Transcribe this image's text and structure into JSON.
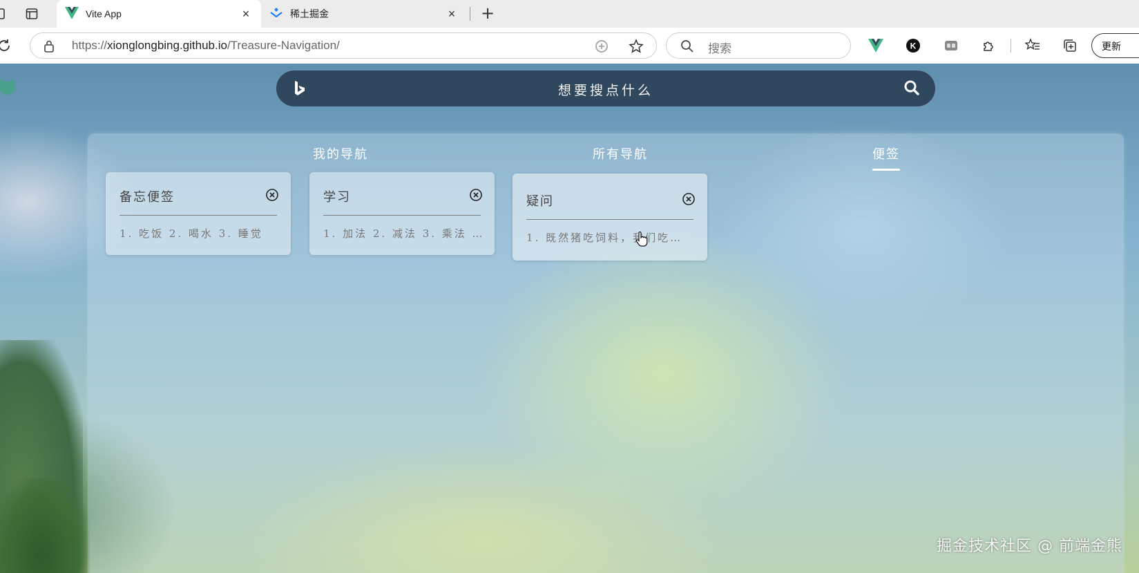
{
  "browser": {
    "tabs": [
      {
        "title": "Vite App",
        "icon": "vue-icon",
        "active": true
      },
      {
        "title": "稀土掘金",
        "icon": "juejin-icon",
        "active": false
      }
    ],
    "new_tab_label": "+",
    "close_label": "×",
    "address": {
      "scheme": "https://",
      "host": "xionglongbing.github.io",
      "path": "/Treasure-Navigation/"
    },
    "search_placeholder": "搜索",
    "update_button": "更新"
  },
  "page": {
    "search": {
      "placeholder": "想要搜点什么"
    },
    "tabs": [
      {
        "label": "我的导航",
        "active": false
      },
      {
        "label": "所有导航",
        "active": false
      },
      {
        "label": "便签",
        "active": true
      }
    ],
    "notes": [
      {
        "title": "备忘便签",
        "body": "1. 吃饭 2. 喝水 3. 睡觉"
      },
      {
        "title": "学习",
        "body": "1. 加法 2. 减法 3. 乘法 …"
      },
      {
        "title": "疑问",
        "body": "1. 既然猪吃饲料，我们吃…"
      }
    ],
    "watermark": "掘金技术社区 @ 前端金熊"
  },
  "colors": {
    "accent": "#41b883",
    "search_bar": "#23374b",
    "panel": "#c6deec"
  }
}
